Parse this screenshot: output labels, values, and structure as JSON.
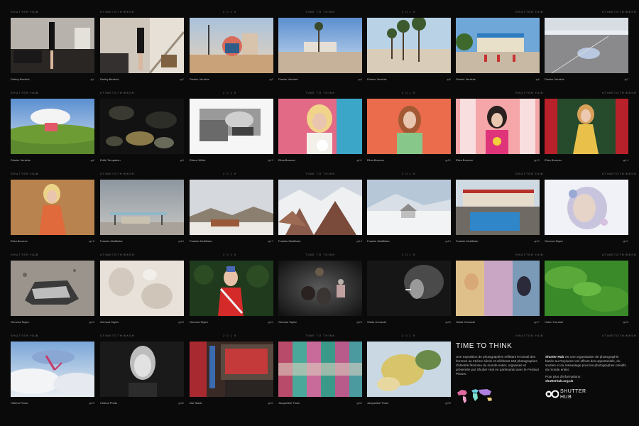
{
  "row_headers": [
    "SHUTTER HUB",
    "#TIMETOTHINKSH",
    "2 0 1 9",
    "TIME TO THINK",
    "2 0 1 9",
    "SHUTTER HUB",
    "#TIMETOTHINKSH"
  ],
  "photos": [
    {
      "caption": "Debby Besford",
      "number": "1"
    },
    {
      "caption": "Debby Besford",
      "number": "2"
    },
    {
      "caption": "Dineke Versluis",
      "number": "3"
    },
    {
      "caption": "Dineke Versluis",
      "number": "4"
    },
    {
      "caption": "Dineke Versluis",
      "number": "5"
    },
    {
      "caption": "Dineke Versluis",
      "number": "6"
    },
    {
      "caption": "Dineke Versluis",
      "number": "7"
    },
    {
      "caption": "Dineke Versluis",
      "number": "8"
    },
    {
      "caption": "Edith Templeton",
      "number": "9"
    },
    {
      "caption": "Eileen White",
      "number": "10"
    },
    {
      "caption": "Eliza Bourner",
      "number": "11"
    },
    {
      "caption": "Eliza Bourner",
      "number": "12"
    },
    {
      "caption": "Eliza Bourner",
      "number": "13"
    },
    {
      "caption": "Eliza Bourner",
      "number": "14"
    },
    {
      "caption": "Eliza Bourner",
      "number": "15"
    },
    {
      "caption": "Frankie McAllister",
      "number": "16"
    },
    {
      "caption": "Frankie McAllister",
      "number": "17"
    },
    {
      "caption": "Frankie McAllister",
      "number": "18"
    },
    {
      "caption": "Frankie McAllister",
      "number": "19"
    },
    {
      "caption": "Frankie McAllister",
      "number": "20"
    },
    {
      "caption": "Gemma Taylor",
      "number": "21"
    },
    {
      "caption": "Gemma Taylor",
      "number": "22"
    },
    {
      "caption": "Gemma Taylor",
      "number": "23"
    },
    {
      "caption": "Gemma Taylor",
      "number": "24"
    },
    {
      "caption": "Gemma Taylor",
      "number": "25"
    },
    {
      "caption": "Giulia Corsechi",
      "number": "26"
    },
    {
      "caption": "Giulia Corsechi",
      "number": "27"
    },
    {
      "caption": "Helen Turnbull",
      "number": "28"
    },
    {
      "caption": "Helena Photo",
      "number": "29"
    },
    {
      "caption": "Helena Photo",
      "number": "30"
    },
    {
      "caption": "Ilse Stack",
      "number": "31"
    },
    {
      "caption": "Jacqueline Thow",
      "number": "32"
    },
    {
      "caption": "Jacqueline Thow",
      "number": "33"
    }
  ],
  "info": {
    "title": "TIME TO THINK",
    "body": "Une exposition de photographies reflétant le travail des femmes au 21ème siècle et célébrant 155 photographes d'identité féminine du monde entier, organisée et présentée par Shutter Hub en partenariat avec le Festival PiOurs."
  },
  "about": {
    "brand": "Shutter Hub",
    "text": " est une organisation de photographie basée au Royaume-Uni offrant des opportunités, du soutien et du réseautage pour les photographes créatifs du monde entier.",
    "more": "Pour plus d'informations :",
    "url": "shutterhub.org.uk"
  },
  "logo": {
    "line1": "SHUTTER",
    "line2": "HUB"
  },
  "colors": {
    "background": "#0a0a0a",
    "text": "#bdbdbd",
    "header": "#7a7a7a"
  }
}
